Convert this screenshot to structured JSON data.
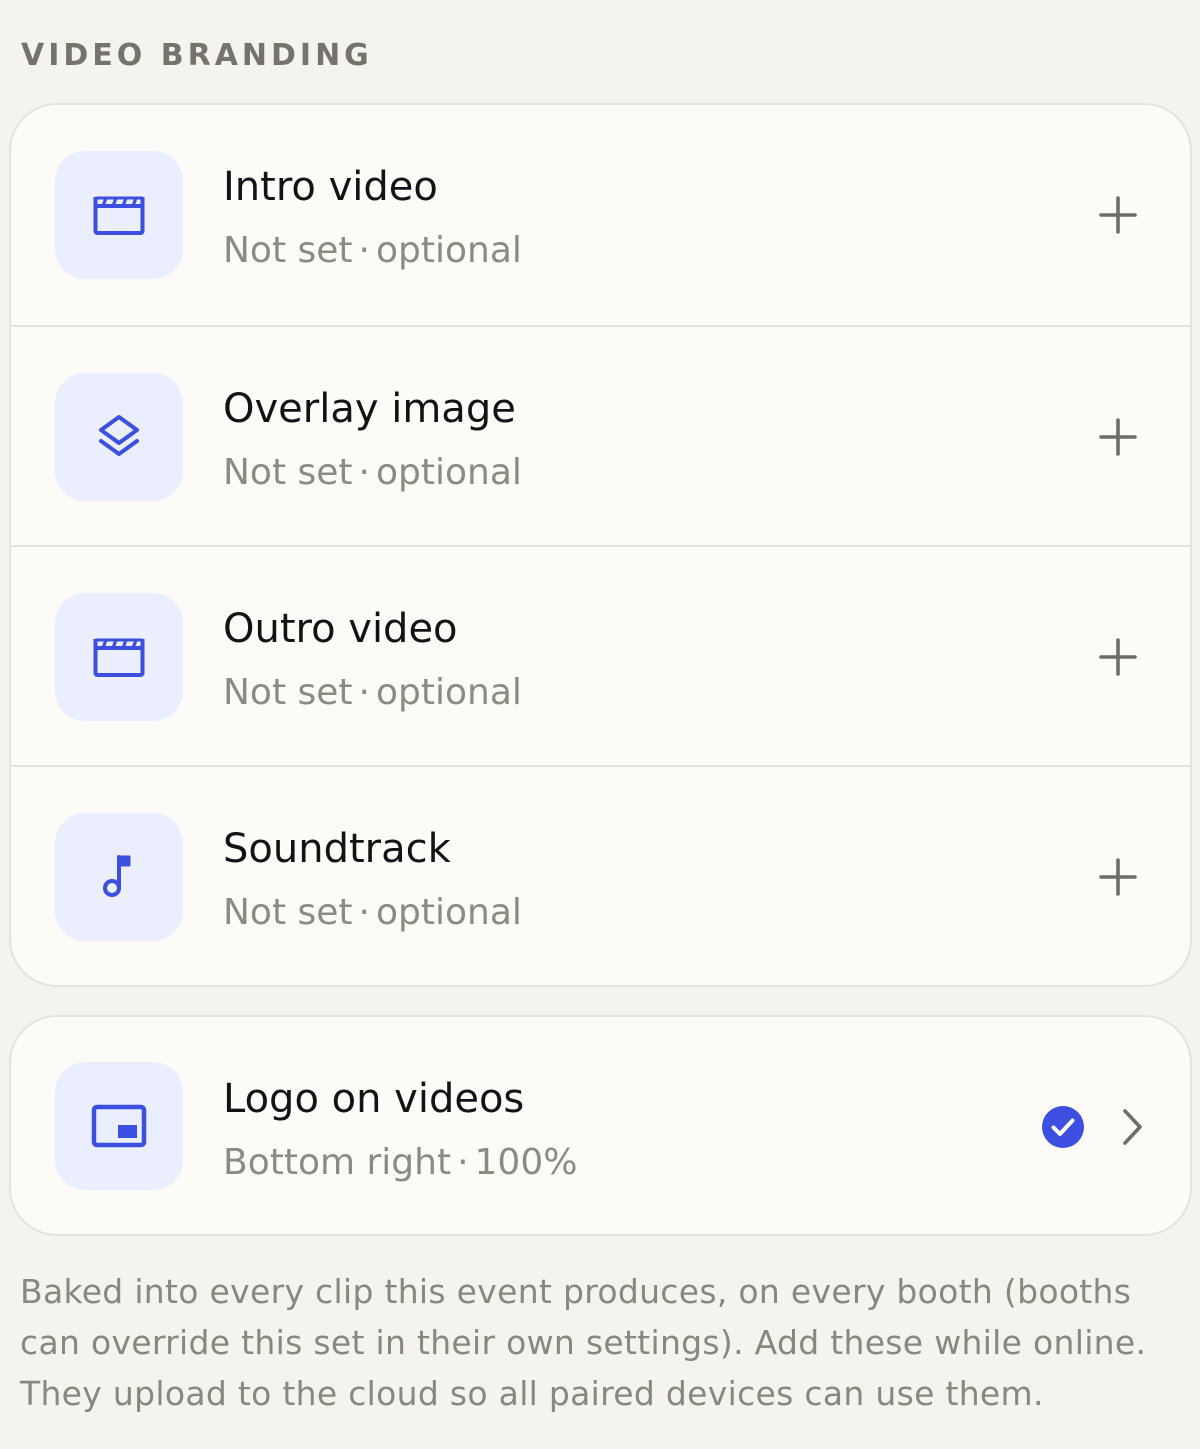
{
  "section": {
    "title": "VIDEO BRANDING"
  },
  "colors": {
    "accent": "#3c4fe0",
    "icon_tile_bg": "#eaeefd",
    "page_bg": "#f4f3f0",
    "card_bg": "#fcfbf8"
  },
  "items": [
    {
      "title": "Intro video",
      "status": "Not set",
      "qualifier": "optional",
      "icon": "clapperboard-icon",
      "action_icon": "plus-icon"
    },
    {
      "title": "Overlay image",
      "status": "Not set",
      "qualifier": "optional",
      "icon": "layers-icon",
      "action_icon": "plus-icon"
    },
    {
      "title": "Outro video",
      "status": "Not set",
      "qualifier": "optional",
      "icon": "clapperboard-icon",
      "action_icon": "plus-icon"
    },
    {
      "title": "Soundtrack",
      "status": "Not set",
      "qualifier": "optional",
      "icon": "music-note-icon",
      "action_icon": "plus-icon"
    }
  ],
  "logo": {
    "title": "Logo on videos",
    "position": "Bottom right",
    "scale": "100%",
    "icon": "picture-in-picture-icon",
    "status_icon": "check-circle-icon",
    "action_icon": "chevron-right-icon"
  },
  "separator": "·",
  "footnote": "Baked into every clip this event produces, on every booth (booths can override this set in their own settings). Add these while online. They upload to the cloud so all paired devices can use them."
}
